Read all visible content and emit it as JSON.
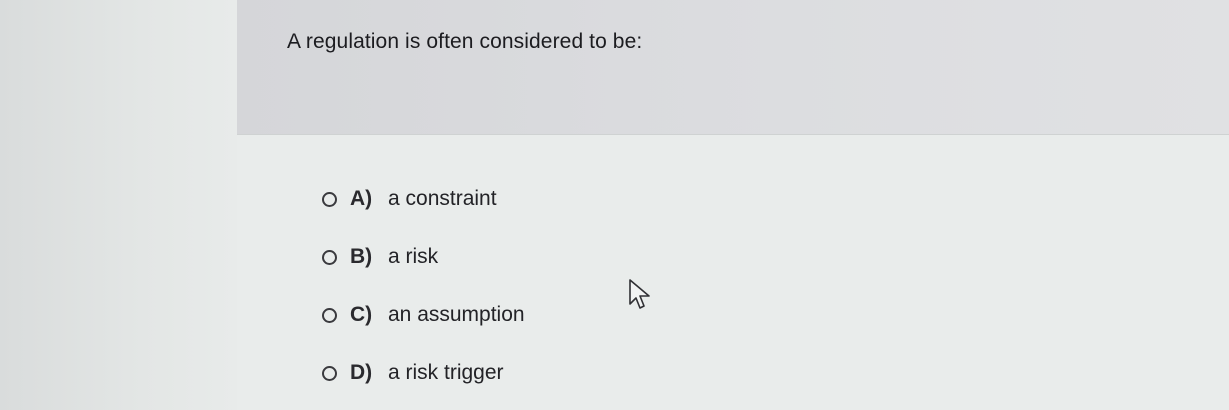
{
  "question": {
    "text": "A regulation is often considered to be:"
  },
  "options": [
    {
      "letter": "A)",
      "text": "a constraint",
      "selected": false
    },
    {
      "letter": "B)",
      "text": "a risk",
      "selected": false
    },
    {
      "letter": "C)",
      "text": "an assumption",
      "selected": false
    },
    {
      "letter": "D)",
      "text": "a risk trigger",
      "selected": false
    }
  ],
  "cursor": {
    "icon": "mouse-pointer-icon"
  },
  "colors": {
    "page_background": "#e9eceb",
    "question_panel": "#dcdde0",
    "text": "#1f1f22"
  }
}
